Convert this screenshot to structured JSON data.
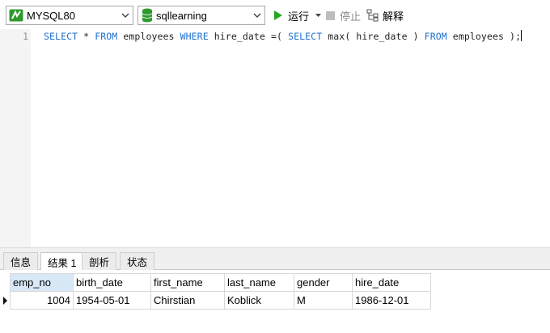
{
  "toolbar": {
    "connection": "MYSQL80",
    "database": "sqllearning",
    "run_label": "运行",
    "stop_label": "停止",
    "explain_label": "解释"
  },
  "editor": {
    "line_number": "1",
    "query_parts": [
      "SELECT",
      " * ",
      "FROM",
      " employees ",
      "WHERE",
      " hire_date =( ",
      "SELECT",
      " max( hire_date ) ",
      "FROM",
      " employees );"
    ]
  },
  "result_tabs": [
    "信息",
    "结果 1",
    "剖析",
    "状态"
  ],
  "active_tab": "结果 1",
  "grid": {
    "columns": [
      "emp_no",
      "birth_date",
      "first_name",
      "last_name",
      "gender",
      "hire_date"
    ],
    "rows": [
      [
        "1004",
        "1954-05-01",
        "Chirstian",
        "Koblick",
        "M",
        "1986-12-01"
      ]
    ]
  },
  "colors": {
    "keyword": "#1e6fd0",
    "run_green": "#23a823",
    "db_green": "#2e9a2e"
  }
}
